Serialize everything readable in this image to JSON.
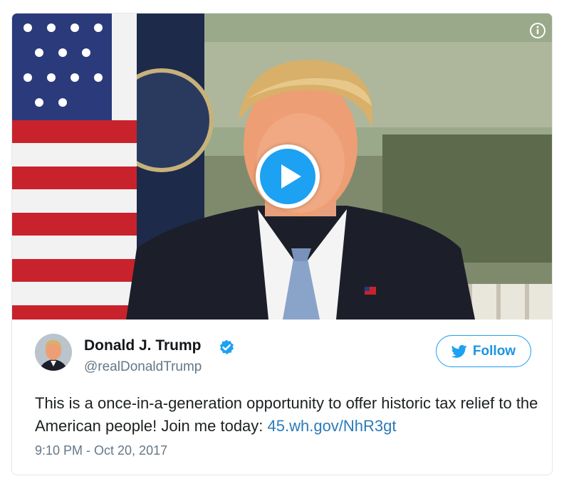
{
  "tweet": {
    "author": {
      "display_name": "Donald J. Trump",
      "handle": "@realDonaldTrump",
      "verified": true
    },
    "follow_label": "Follow",
    "text": "This is a once-in-a-generation opportunity to offer historic tax relief to the American people! Join me today: ",
    "link_text": "45.wh.gov/NhR3gt",
    "timestamp": "9:10 PM - Oct 20, 2017"
  },
  "media": {
    "type": "video",
    "play_icon": "play-icon",
    "info_icon": "info-icon"
  },
  "colors": {
    "accent": "#1da1f2",
    "link": "#2b7bb9",
    "secondary_text": "#657786",
    "primary_text": "#1c2022",
    "border": "#e1e8ed"
  }
}
